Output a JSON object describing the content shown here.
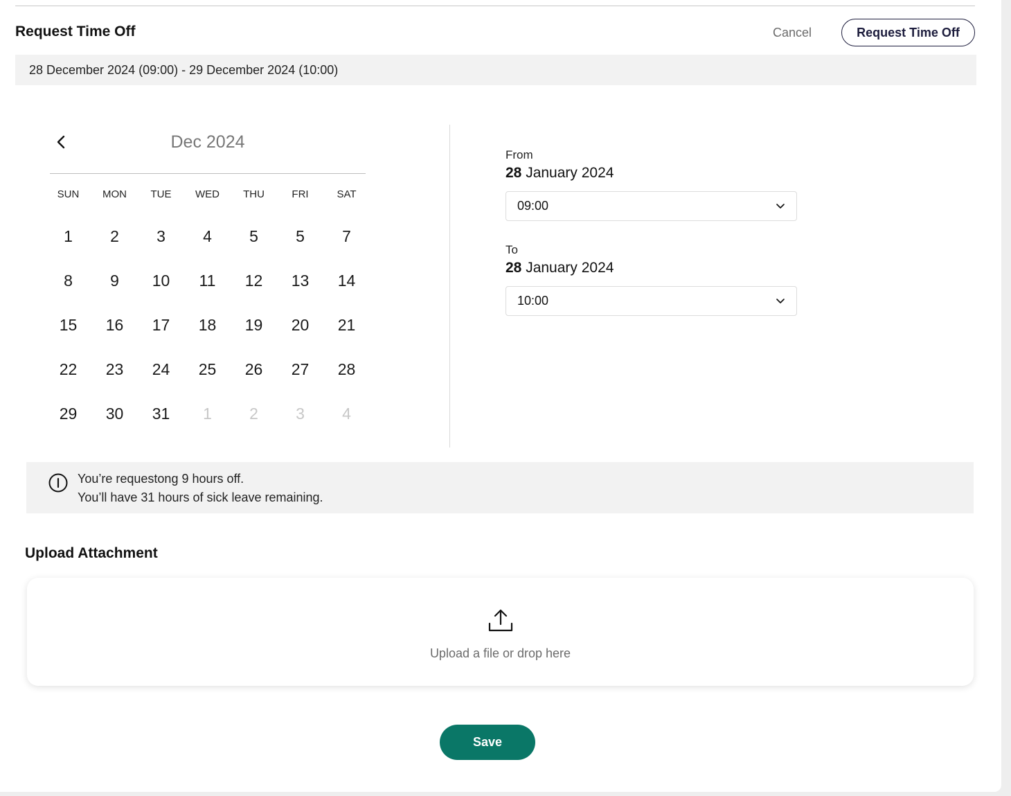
{
  "header": {
    "title": "Request Time Off",
    "cancel_label": "Cancel",
    "request_button_label": "Request Time Off"
  },
  "selected_range": "28 December 2024 (09:00) - 29 December  2024 (10:00)",
  "calendar": {
    "month_label": "Dec 2024",
    "prev_icon": "chevron-left-icon",
    "weekdays": [
      "SUN",
      "MON",
      "TUE",
      "WED",
      "THU",
      "FRI",
      "SAT"
    ],
    "days": [
      {
        "label": "1",
        "muted": false
      },
      {
        "label": "2",
        "muted": false
      },
      {
        "label": "3",
        "muted": false
      },
      {
        "label": "4",
        "muted": false
      },
      {
        "label": "5",
        "muted": false
      },
      {
        "label": "5",
        "muted": false
      },
      {
        "label": "7",
        "muted": false
      },
      {
        "label": "8",
        "muted": false
      },
      {
        "label": "9",
        "muted": false
      },
      {
        "label": "10",
        "muted": false
      },
      {
        "label": "11",
        "muted": false
      },
      {
        "label": "12",
        "muted": false
      },
      {
        "label": "13",
        "muted": false
      },
      {
        "label": "14",
        "muted": false
      },
      {
        "label": "15",
        "muted": false
      },
      {
        "label": "16",
        "muted": false
      },
      {
        "label": "17",
        "muted": false
      },
      {
        "label": "18",
        "muted": false
      },
      {
        "label": "19",
        "muted": false
      },
      {
        "label": "20",
        "muted": false
      },
      {
        "label": "21",
        "muted": false
      },
      {
        "label": "22",
        "muted": false
      },
      {
        "label": "23",
        "muted": false
      },
      {
        "label": "24",
        "muted": false
      },
      {
        "label": "25",
        "muted": false
      },
      {
        "label": "26",
        "muted": false
      },
      {
        "label": "27",
        "muted": false
      },
      {
        "label": "28",
        "muted": false
      },
      {
        "label": "29",
        "muted": false
      },
      {
        "label": "30",
        "muted": false
      },
      {
        "label": "31",
        "muted": false
      },
      {
        "label": "1",
        "muted": true
      },
      {
        "label": "2",
        "muted": true
      },
      {
        "label": "3",
        "muted": true
      },
      {
        "label": "4",
        "muted": true
      }
    ]
  },
  "from": {
    "label": "From",
    "day": "28",
    "month_year": "January 2024",
    "time": "09:00",
    "dropdown_icon": "chevron-down-icon"
  },
  "to": {
    "label": "To",
    "day": "28",
    "month_year": "January 2024",
    "time": "10:00",
    "dropdown_icon": "chevron-down-icon"
  },
  "info": {
    "icon": "info-icon",
    "line1": "You’re requestong 9 hours off.",
    "line2": "You’ll have 31 hours of sick leave remaining."
  },
  "upload": {
    "title": "Upload Attachment",
    "icon": "upload-icon",
    "prompt": "Upload a file or drop here"
  },
  "save_label": "Save",
  "colors": {
    "accent": "#0a7767",
    "panel_gray": "#f2f2f2",
    "muted_text": "#c7c7c7"
  }
}
